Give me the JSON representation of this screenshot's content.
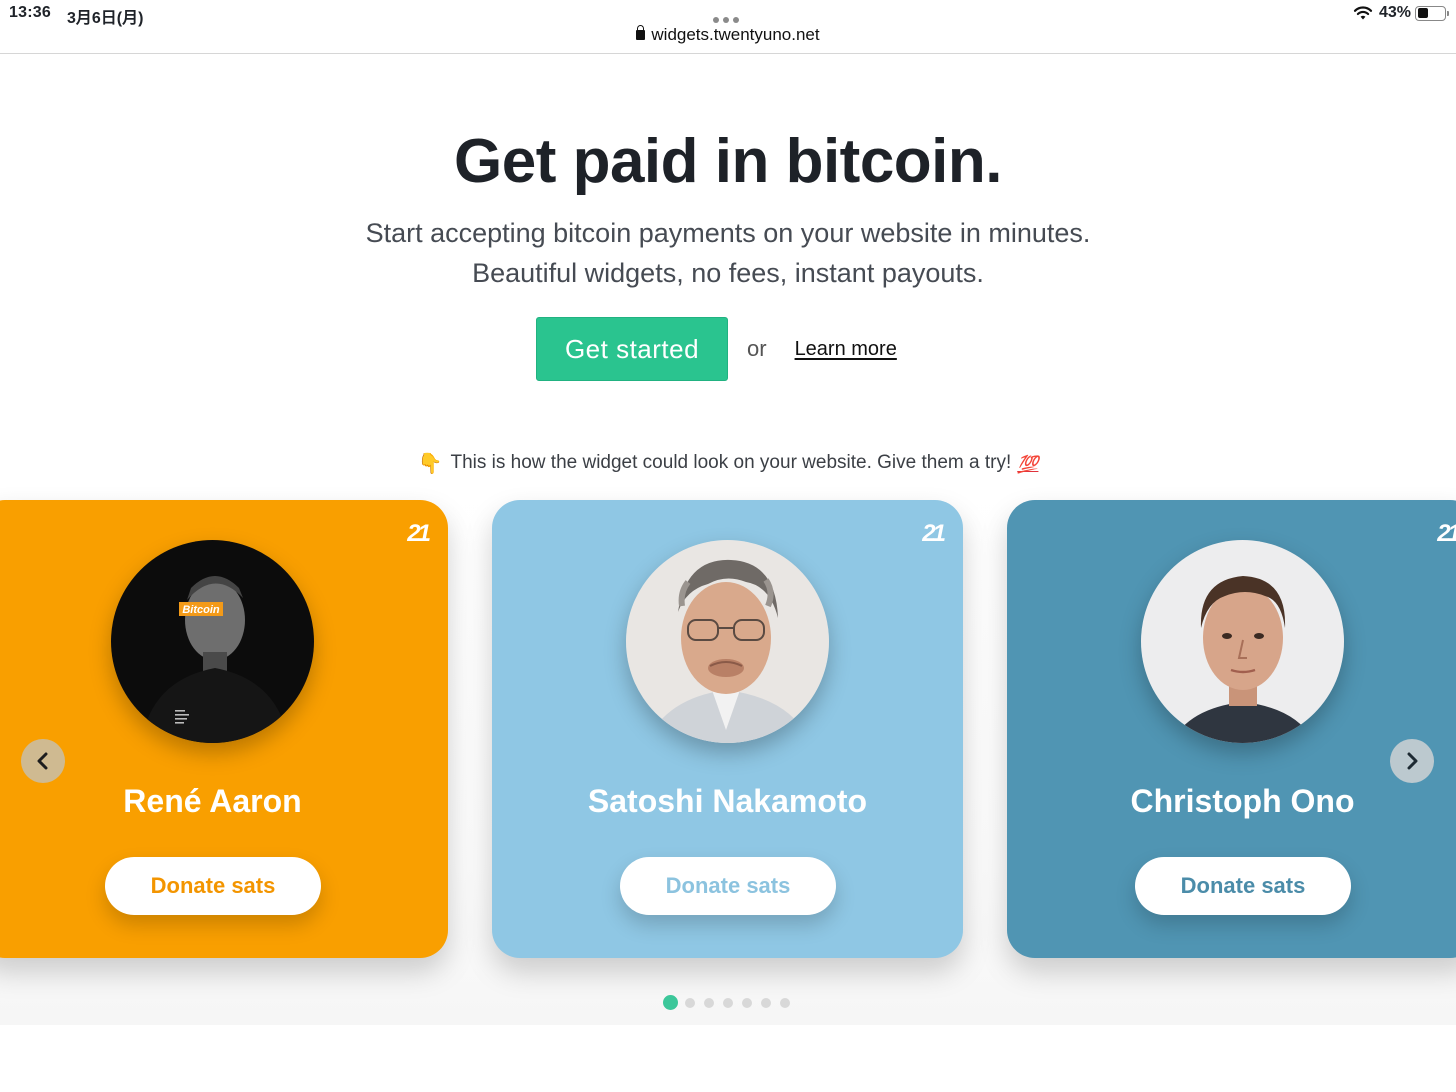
{
  "status_bar": {
    "time": "13:36",
    "date": "3月6日(月)",
    "url": "widgets.twentyuno.net",
    "battery": "43%",
    "battery_level": 0.43
  },
  "hero": {
    "title": "Get paid in bitcoin.",
    "subtitle_line1": "Start accepting bitcoin payments on your website in minutes.",
    "subtitle_line2": "Beautiful widgets, no fees, instant payouts.",
    "cta_primary": "Get started",
    "cta_or": "or",
    "cta_link": "Learn more"
  },
  "hint": {
    "emoji_left": "👇",
    "text": "This is how the widget could look on your website. Give them a try!",
    "emoji_right": "💯"
  },
  "carousel": {
    "cards": [
      {
        "name": "René Aaron",
        "button": "Donate sats",
        "badge": "21",
        "avatar_tag": "Bitcoin",
        "color": "#f99f00"
      },
      {
        "name": "Satoshi Nakamoto",
        "button": "Donate sats",
        "badge": "21",
        "color": "#8fc7e4"
      },
      {
        "name": "Christoph Ono",
        "button": "Donate sats",
        "badge": "21",
        "color": "#5095b3"
      }
    ],
    "prev_icon": "chevron-left-icon",
    "next_icon": "chevron-right-icon",
    "page_count": 7,
    "active_page": 1,
    "accent": "#2ac48f"
  }
}
